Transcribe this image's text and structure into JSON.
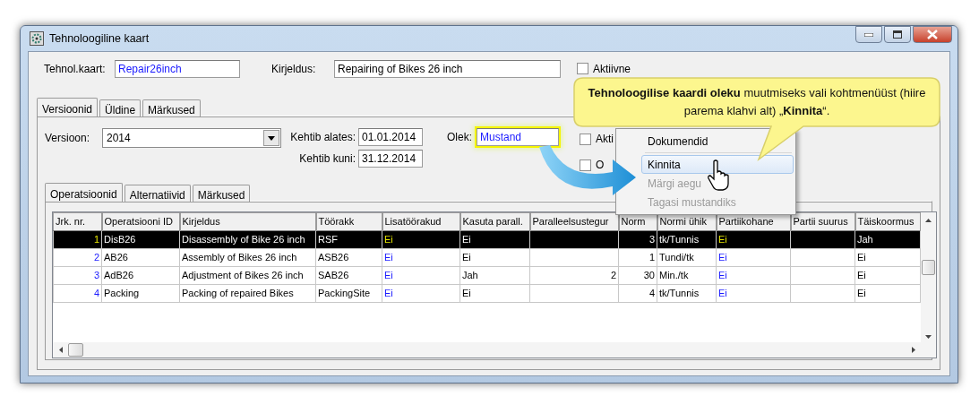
{
  "window": {
    "title": "Tehnoloogiline kaart"
  },
  "header": {
    "fields": [
      {
        "label": "Tehnol.kaart:",
        "value": "Repair26inch",
        "kind": "code"
      },
      {
        "label": "Kirjeldus:",
        "value": "Repairing of Bikes 26 inch",
        "kind": "text"
      }
    ],
    "active": {
      "label": "Aktiivne",
      "checked": false
    }
  },
  "tabs": [
    {
      "label": "Versioonid",
      "selected": true
    },
    {
      "label": "Üldine",
      "selected": false
    },
    {
      "label": "Märkused",
      "selected": false
    }
  ],
  "version": {
    "version": {
      "label": "Versioon:",
      "value": "2014"
    },
    "valid_from": {
      "label": "Kehtib alates:",
      "value": "01.01.2014"
    },
    "valid_to": {
      "label": "Kehtib kuni:",
      "value": "31.12.2014"
    },
    "state": {
      "label": "Olek:",
      "value": "Mustand",
      "highlighted": true
    },
    "checkboxes": [
      {
        "label": "Akti",
        "checked": false
      },
      {
        "label": "O",
        "checked": false
      }
    ]
  },
  "subtabs": [
    {
      "label": "Operatsioonid",
      "selected": true
    },
    {
      "label": "Alternatiivid",
      "selected": false
    },
    {
      "label": "Märkused",
      "selected": false
    }
  ],
  "table": {
    "columns": [
      {
        "label": "Jrk. nr.",
        "kind": "index"
      },
      {
        "label": "Operatsiooni ID",
        "kind": "text"
      },
      {
        "label": "Kirjeldus",
        "kind": "text"
      },
      {
        "label": "Töörakk",
        "kind": "text"
      },
      {
        "label": "Lisatöörakud",
        "kind": "flag"
      },
      {
        "label": "Kasuta parall.",
        "kind": "text"
      },
      {
        "label": "Paralleelsustegur",
        "kind": "number"
      },
      {
        "label": "Norm",
        "kind": "number"
      },
      {
        "label": "Normi ühik",
        "kind": "text"
      },
      {
        "label": "Partiikohane",
        "kind": "flag"
      },
      {
        "label": "Partii suurus",
        "kind": "text"
      },
      {
        "label": "Täiskoormus",
        "kind": "text"
      }
    ],
    "rows": [
      {
        "selected": true,
        "cells": [
          "1",
          "DisB26",
          "Disassembly of Bike 26 inch",
          "RSF",
          "Ei",
          "Ei",
          null,
          "3",
          "tk/Tunnis",
          "Ei",
          null,
          "Jah"
        ]
      },
      {
        "selected": false,
        "cells": [
          "2",
          "AB26",
          "Assembly of Bikes 26 inch",
          "ASB26",
          "Ei",
          "Ei",
          null,
          "1",
          "Tundi/tk",
          "Ei",
          null,
          "Ei"
        ]
      },
      {
        "selected": false,
        "cells": [
          "3",
          "AdB26",
          "Adjustment of Bikes 26 inch",
          "SAB26",
          "Ei",
          "Jah",
          "2",
          "30",
          "Min./tk",
          "Ei",
          null,
          "Ei"
        ]
      },
      {
        "selected": false,
        "cells": [
          "4",
          "Packing",
          "Packing of repaired Bikes",
          "PackingSite",
          "Ei",
          "Ei",
          null,
          "4",
          "tk/Tunnis",
          "Ei",
          null,
          "Ei"
        ]
      }
    ]
  },
  "context_menu": {
    "items": [
      {
        "label": "Dokumendid",
        "highlighted": false,
        "disabled": false,
        "divider_after": true
      },
      {
        "label": "Kinnita",
        "highlighted": true,
        "disabled": false,
        "divider_after": false
      },
      {
        "label": "Märgi aegu",
        "highlighted": false,
        "disabled": true,
        "divider_after": false
      },
      {
        "label": "Tagasi mustandiks",
        "highlighted": false,
        "disabled": true,
        "divider_after": false
      }
    ]
  },
  "callout": {
    "text": "**Tehnoloogilise  kaardi oleku** muutmiseks vali kohtmenüüst (hiire parema klahvi alt) „**Kinnita**“."
  }
}
